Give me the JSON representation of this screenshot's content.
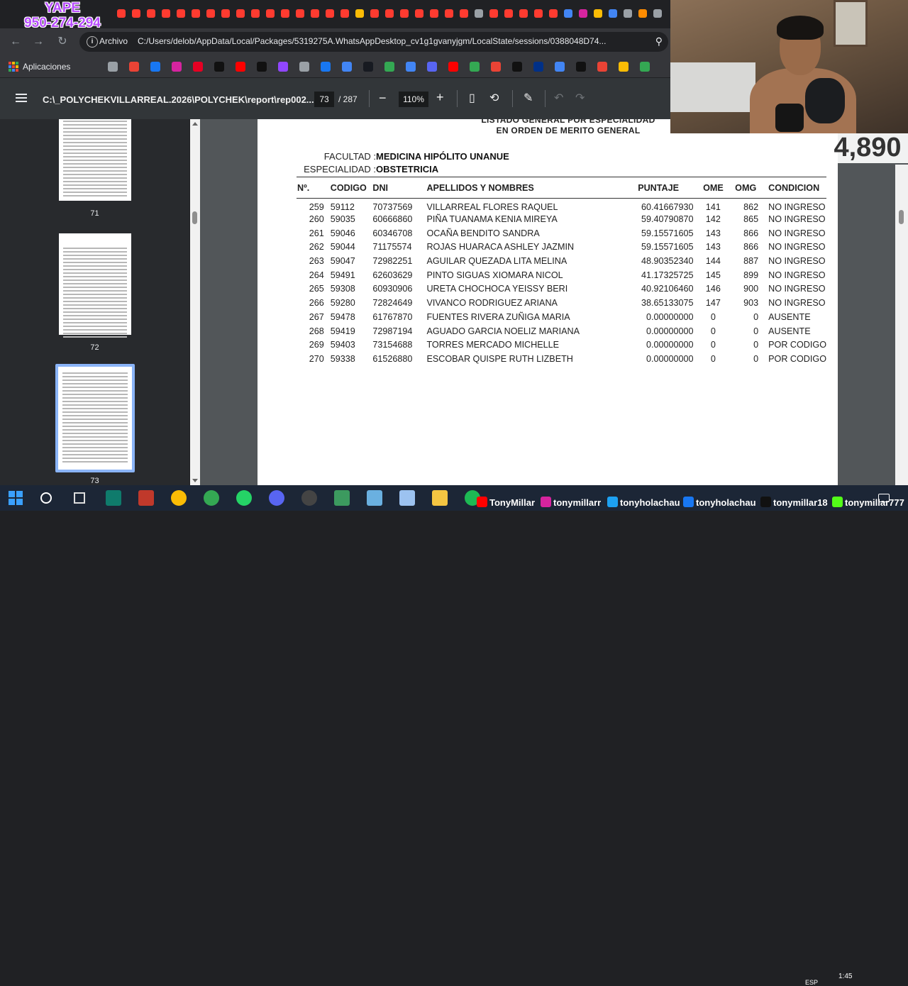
{
  "overlay": {
    "yape_label": "YAPE",
    "yape_number": "950-274-294",
    "viewer_count": "4,890"
  },
  "browser": {
    "scheme_label": "Archivo",
    "url": "C:/Users/delob/AppData/Local/Packages/5319275A.WhatsAppDesktop_cv1g1gvanyjgm/LocalState/sessions/0388048D74...",
    "bookmarks_label": "Aplicaciones"
  },
  "pdf_toolbar": {
    "title": "C:\\_POLYCHEKVILLARREAL.2026\\POLYCHEK\\report\\rep002....",
    "current_page": "73",
    "total_pages": "/ 287",
    "zoom": "110%"
  },
  "sidebar": {
    "labels": [
      "71",
      "72",
      "73"
    ]
  },
  "document": {
    "heading_line1": "LISTADO GENERAL POR ESPECIALIDAD",
    "heading_line2": "EN ORDEN DE MERITO GENERAL",
    "faculty_label": "FACULTAD :",
    "faculty_value": "MEDICINA HIPÓLITO UNANUE",
    "specialty_label": "ESPECIALIDAD :",
    "specialty_value": "OBSTETRICIA",
    "columns": [
      "Nº.",
      "CODIGO",
      "DNI",
      "APELLIDOS Y NOMBRES",
      "PUNTAJE",
      "OME",
      "OMG",
      "CONDICION"
    ],
    "rows": [
      [
        "259",
        "59112",
        "70737569",
        "VILLARREAL FLORES RAQUEL",
        "60.41667930",
        "141",
        "862",
        "NO INGRESO"
      ],
      [
        "260",
        "59035",
        "60666860",
        "PIÑA TUANAMA KENIA MIREYA",
        "59.40790870",
        "142",
        "865",
        "NO INGRESO"
      ],
      [
        "261",
        "59046",
        "60346708",
        "OCAÑA BENDITO SANDRA",
        "59.15571605",
        "143",
        "866",
        "NO INGRESO"
      ],
      [
        "262",
        "59044",
        "71175574",
        "ROJAS HUARACA ASHLEY JAZMIN",
        "59.15571605",
        "143",
        "866",
        "NO INGRESO"
      ],
      [
        "263",
        "59047",
        "72982251",
        "AGUILAR QUEZADA LITA MELINA",
        "48.90352340",
        "144",
        "887",
        "NO INGRESO"
      ],
      [
        "264",
        "59491",
        "62603629",
        "PINTO SIGUAS XIOMARA NICOL",
        "41.17325725",
        "145",
        "899",
        "NO INGRESO"
      ],
      [
        "265",
        "59308",
        "60930906",
        "URETA CHOCHOCA YEISSY BERI",
        "40.92106460",
        "146",
        "900",
        "NO INGRESO"
      ],
      [
        "266",
        "59280",
        "72824649",
        "VIVANCO RODRIGUEZ ARIANA",
        "38.65133075",
        "147",
        "903",
        "NO INGRESO"
      ],
      [
        "267",
        "59478",
        "61767870",
        "FUENTES RIVERA ZUÑIGA MARIA",
        "0.00000000",
        "0",
        "0",
        "AUSENTE"
      ],
      [
        "268",
        "59419",
        "72987194",
        "AGUADO GARCIA NOELIZ MARIANA",
        "0.00000000",
        "0",
        "0",
        "AUSENTE"
      ],
      [
        "269",
        "59403",
        "73154688",
        "TORRES MERCADO MICHELLE",
        "0.00000000",
        "0",
        "0",
        "POR CODIGO"
      ],
      [
        "270",
        "59338",
        "61526880",
        "ESCOBAR QUISPE RUTH LIZBETH",
        "0.00000000",
        "0",
        "0",
        "POR CODIGO"
      ]
    ]
  },
  "taskbar": {
    "social": [
      {
        "icon": "youtube-icon",
        "handle": "TonyMillar",
        "color": "#ff0000"
      },
      {
        "icon": "instagram-icon",
        "handle": "tonymillarr",
        "color": "#d6249f"
      },
      {
        "icon": "twitter-icon",
        "handle": "tonyholachau",
        "color": "#1da1f2"
      },
      {
        "icon": "facebook-icon",
        "handle": "tonyholachau",
        "color": "#1877f2"
      },
      {
        "icon": "tiktok-icon",
        "handle": "tonymillar18",
        "color": "#111111"
      },
      {
        "icon": "kick-icon",
        "handle": "tonymillar777",
        "color": "#53fc18"
      }
    ],
    "time": "1:45",
    "language": "ESP"
  }
}
